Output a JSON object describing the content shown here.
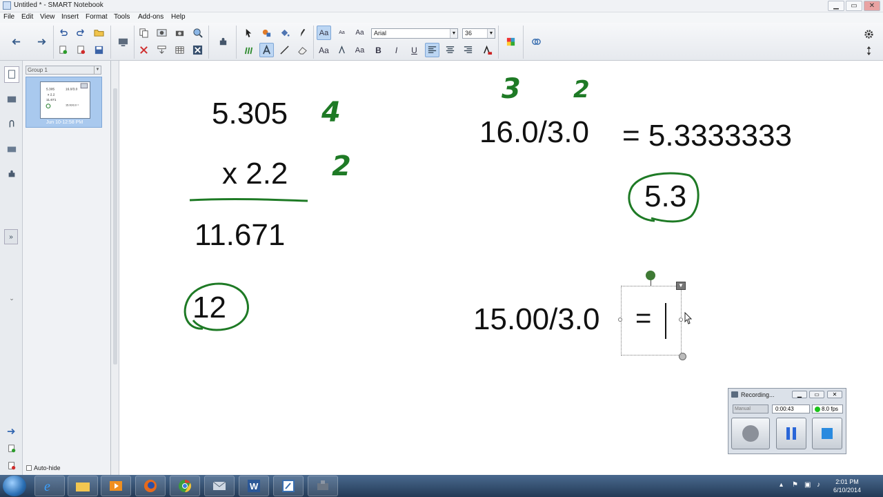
{
  "window": {
    "title": "Untitled * - SMART Notebook",
    "minimize": "▁",
    "restore": "▭",
    "close": "✕"
  },
  "menu": {
    "items": [
      "File",
      "Edit",
      "View",
      "Insert",
      "Format",
      "Tools",
      "Add-ons",
      "Help"
    ]
  },
  "toolbar": {
    "font_name": "Arial",
    "font_size": "36",
    "text_buttons": {
      "aa_large": "Aa",
      "aa_small": "Aa",
      "aa_plain": "Aa",
      "aa_row2a": "Aa",
      "aa_row2b": "Aa",
      "bold": "B",
      "italic": "I",
      "underline": "U"
    }
  },
  "sorter": {
    "group_label": "Group 1",
    "page_date": "Jun 10-12:58 PM",
    "autohide_label": "Auto-hide"
  },
  "canvas": {
    "typed": {
      "mult_top": "5.305",
      "mult_bottom": "x 2.2",
      "mult_result": "11.671",
      "rounded_product": "12",
      "div1": "16.0/3.0",
      "div1_result": "= 5.3333333",
      "div1_rounded": "5.3",
      "div2": "15.00/3.0",
      "div2_equals": "="
    },
    "handwritten": {
      "sigfig_top": "4",
      "sigfig_bottom": "2",
      "sigfig_16": "3",
      "sigfig_3": "2"
    }
  },
  "recorder": {
    "title": "Recording...",
    "mode": "Manual",
    "elapsed": "0:00:43",
    "fps": "8.0 fps"
  },
  "taskbar": {
    "time": "2:01 PM",
    "date": "6/10/2014"
  },
  "colors": {
    "ink_green": "#1e7a25",
    "selection_blue": "#bcd6f3",
    "taskbar": "#2b4668"
  }
}
